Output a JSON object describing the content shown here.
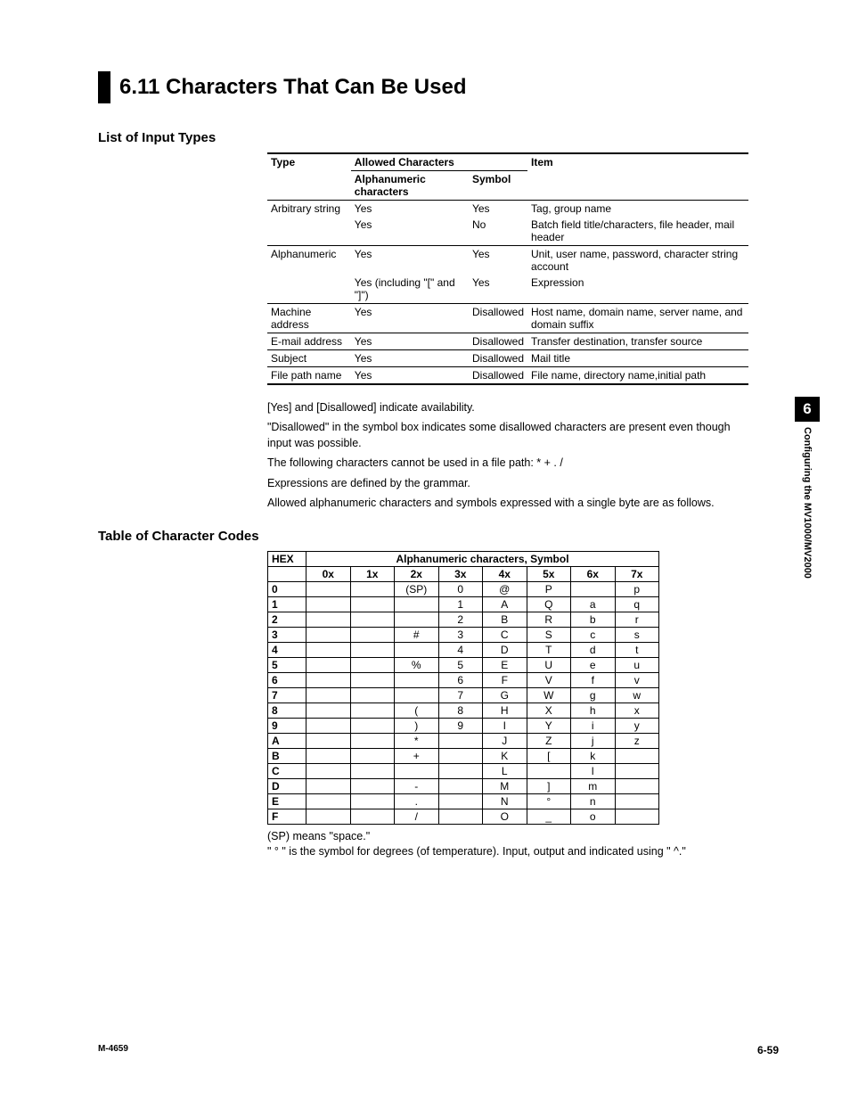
{
  "heading": "6.11  Characters That Can Be Used",
  "subhead_input_types": "List of Input Types",
  "input_table": {
    "head1": {
      "type": "Type",
      "allowed": "Allowed Characters",
      "item": "Item"
    },
    "head2": {
      "alpha": "Alphanumeric characters",
      "symbol": "Symbol"
    },
    "rows": [
      {
        "type": "Arbitrary string",
        "alpha": "Yes",
        "symbol": "Yes",
        "item": "Tag, group name",
        "divider": false
      },
      {
        "type": "",
        "alpha": "Yes",
        "symbol": "No",
        "item": "Batch field title/characters, file header, mail header",
        "divider": true
      },
      {
        "type": "Alphanumeric",
        "alpha": "Yes",
        "symbol": "Yes",
        "item": "Unit, user name, password, character string account",
        "divider": false
      },
      {
        "type": "",
        "alpha": "Yes (including \"[\" and \"]\")",
        "symbol": "Yes",
        "item": "Expression",
        "divider": true
      },
      {
        "type": "Machine address",
        "alpha": "Yes",
        "symbol": "Disallowed",
        "item": "Host name, domain name, server name, and domain suffix",
        "divider": true
      },
      {
        "type": "E-mail address",
        "alpha": "Yes",
        "symbol": "Disallowed",
        "item": "Transfer destination, transfer source",
        "divider": true
      },
      {
        "type": "Subject",
        "alpha": "Yes",
        "symbol": "Disallowed",
        "item": "Mail title",
        "divider": true
      },
      {
        "type": "File path name",
        "alpha": "Yes",
        "symbol": "Disallowed",
        "item": "File name, directory name,initial path",
        "divider": false
      }
    ]
  },
  "notes": {
    "n1": "[Yes] and [Disallowed] indicate availability.",
    "n2": "\"Disallowed\" in the symbol box indicates some disallowed characters are present even though input was possible.",
    "n3": "The following characters cannot be used in a file path: * + . /",
    "n4": "Expressions are defined by the grammar.",
    "n5": "Allowed alphanumeric characters and symbols expressed with a single byte are as follows."
  },
  "subhead_char_codes": "Table of Character Codes",
  "char_table": {
    "corner": "HEX",
    "span_header": "Alphanumeric characters, Symbol",
    "cols": [
      "0x",
      "1x",
      "2x",
      "3x",
      "4x",
      "5x",
      "6x",
      "7x"
    ],
    "rows": [
      {
        "k": "0",
        "c": [
          "",
          "",
          "(SP)",
          "0",
          "@",
          "P",
          "",
          "p"
        ]
      },
      {
        "k": "1",
        "c": [
          "",
          "",
          "",
          "1",
          "A",
          "Q",
          "a",
          "q"
        ]
      },
      {
        "k": "2",
        "c": [
          "",
          "",
          "",
          "2",
          "B",
          "R",
          "b",
          "r"
        ]
      },
      {
        "k": "3",
        "c": [
          "",
          "",
          "#",
          "3",
          "C",
          "S",
          "c",
          "s"
        ]
      },
      {
        "k": "4",
        "c": [
          "",
          "",
          "",
          "4",
          "D",
          "T",
          "d",
          "t"
        ]
      },
      {
        "k": "5",
        "c": [
          "",
          "",
          "%",
          "5",
          "E",
          "U",
          "e",
          "u"
        ]
      },
      {
        "k": "6",
        "c": [
          "",
          "",
          "",
          "6",
          "F",
          "V",
          "f",
          "v"
        ]
      },
      {
        "k": "7",
        "c": [
          "",
          "",
          "",
          "7",
          "G",
          "W",
          "g",
          "w"
        ]
      },
      {
        "k": "8",
        "c": [
          "",
          "",
          "(",
          "8",
          "H",
          "X",
          "h",
          "x"
        ]
      },
      {
        "k": "9",
        "c": [
          "",
          "",
          ")",
          "9",
          "I",
          "Y",
          "i",
          "y"
        ]
      },
      {
        "k": "A",
        "c": [
          "",
          "",
          "*",
          "",
          "J",
          "Z",
          "j",
          "z"
        ]
      },
      {
        "k": "B",
        "c": [
          "",
          "",
          "+",
          "",
          "K",
          "[",
          "k",
          ""
        ]
      },
      {
        "k": "C",
        "c": [
          "",
          "",
          "",
          "",
          "L",
          "",
          "l",
          ""
        ]
      },
      {
        "k": "D",
        "c": [
          "",
          "",
          "-",
          "",
          "M",
          "]",
          "m",
          ""
        ]
      },
      {
        "k": "E",
        "c": [
          "",
          "",
          ".",
          "",
          "N",
          "°",
          "n",
          ""
        ]
      },
      {
        "k": "F",
        "c": [
          "",
          "",
          "/",
          "",
          "O",
          "_",
          "o",
          ""
        ]
      }
    ]
  },
  "footnotes": {
    "f1": "(SP) means \"space.\"",
    "f2": "\" ° \"  is the symbol for degrees (of temperature).  Input, output and indicated using \" ^.\""
  },
  "side_tab": {
    "num": "6",
    "label": "Configuring the MV1000/MV2000"
  },
  "footer": {
    "left": "M-4659",
    "right": "6-59"
  }
}
